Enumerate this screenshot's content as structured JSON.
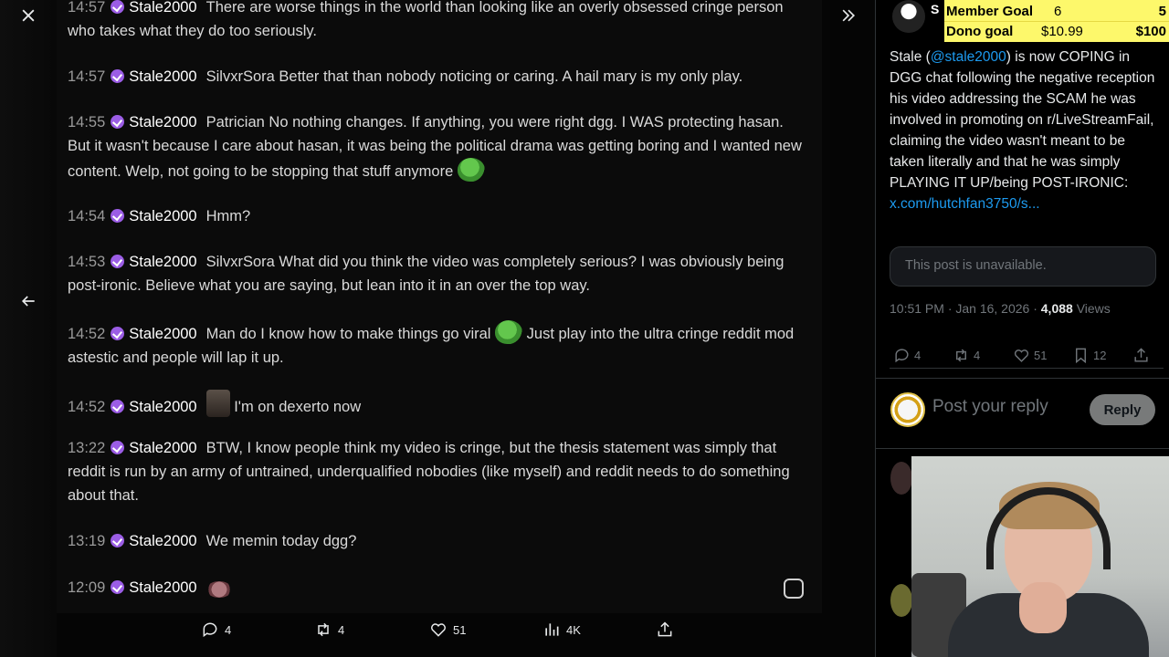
{
  "chat": {
    "messages": [
      {
        "time": "14:57",
        "user": "Stale2000",
        "text": "There are worse things in the world than looking like an overly obsessed cringe person who takes what they do too seriously."
      },
      {
        "time": "14:57",
        "user": "Stale2000",
        "text": "SilvxrSora Better that than nobody noticing or caring. A hail mary is my only play."
      },
      {
        "time": "14:55",
        "user": "Stale2000",
        "text": "Patrician No nothing changes. If anything, you were right dgg. I WAS protecting hasan. But it wasn't because I care about hasan, it was being the political drama was getting boring and I wanted new content. Welp, not going to be stopping that stuff anymore"
      },
      {
        "time": "14:54",
        "user": "Stale2000",
        "text": "Hmm?"
      },
      {
        "time": "14:53",
        "user": "Stale2000",
        "text": "SilvxrSora What did you think the video was completely serious? I was obviously being post-ironic. Believe what you are saying, but lean into it in an over the top way."
      },
      {
        "time": "14:52",
        "user": "Stale2000",
        "text": "Man do I know how to make things go viral",
        "text2": "Just play into the ultra cringe reddit mod astestic and people will lap it up."
      },
      {
        "time": "14:52",
        "user": "Stale2000",
        "text": "I'm on dexerto now"
      },
      {
        "time": "13:22",
        "user": "Stale2000",
        "text": "BTW, I know people think my video is cringe, but the thesis statement was simply that reddit is run by an army of untrained, underqualified nobodies (like myself) and reddit needs to do something about that."
      },
      {
        "time": "13:19",
        "user": "Stale2000",
        "text": "We memin today dgg?"
      },
      {
        "time": "12:09",
        "user": "Stale2000",
        "text": ""
      }
    ]
  },
  "viewer_actions": {
    "replies": "4",
    "reposts": "4",
    "likes": "51",
    "views": "4K"
  },
  "overlay": {
    "letter": "S",
    "member_goal_label": "Member Goal",
    "member_goal_current": "6",
    "member_goal_target": "5",
    "dono_goal_label": "Dono goal",
    "dono_goal_current": "$10.99",
    "dono_goal_target": "$100"
  },
  "post": {
    "text_before_handle": "Stale (",
    "handle": "@stale2000",
    "text_after_handle": ") is now COPING in DGG chat following the negative reception his video addressing the SCAM he was involved in promoting on r/LiveStreamFail, claiming the video wasn't meant to be taken literally and that he was simply PLAYING IT UP/being POST-IRONIC: ",
    "link": "x.com/hutchfan3750/s...",
    "unavailable": "This post is unavailable.",
    "timestamp": "10:51 PM · Jan 16, 2026 · ",
    "views_count": "4,088",
    "views_label": " Views",
    "replies": "4",
    "reposts": "4",
    "likes": "51",
    "bookmarks": "12"
  },
  "reply": {
    "placeholder": "Post your reply",
    "button": "Reply"
  }
}
